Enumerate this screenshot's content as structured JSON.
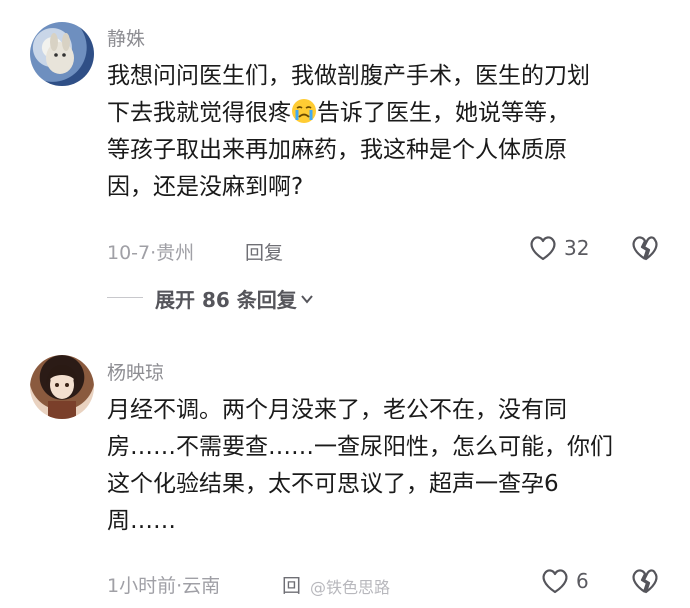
{
  "comments": [
    {
      "username": "静姝",
      "lines": [
        "我想问问医生们，我做剖腹产手术，医生的刀划",
        "下去我就觉得很疼",
        "告诉了医生，她说等等，",
        "等孩子取出来再加麻药，我这种是个人体质原",
        "因，还是没麻到啊?"
      ],
      "time": "10-7",
      "location": "贵州",
      "reply_label": "回复",
      "likes": "32",
      "emoji_icon": "crying-face-icon"
    },
    {
      "username": "杨映琼",
      "lines": [
        "月经不调。两个月没来了，老公不在，没有同",
        "房……不需要查……一查尿阳性，怎么可能，你们",
        "这个化验结果，太不可思议了，超声一查孕6",
        "周……"
      ],
      "time": "1小时前",
      "location": "云南",
      "reply_label": "回",
      "likes": "6"
    }
  ],
  "expand_replies": "展开 86 条回复",
  "watermark": "@铁色思路"
}
